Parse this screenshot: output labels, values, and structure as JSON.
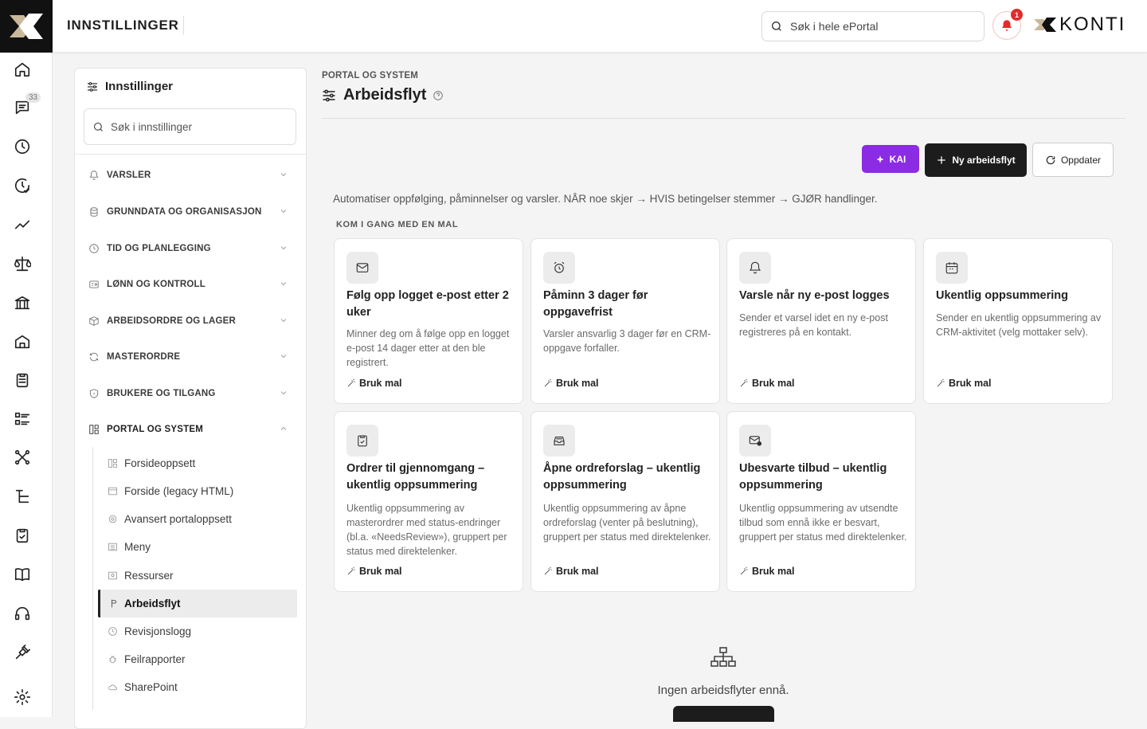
{
  "topbar": {
    "title": "INNSTILLINGER",
    "search_placeholder": "Søk i hele ePortal",
    "notification_count": "1",
    "brand": "KONTI"
  },
  "rail": {
    "chat_badge": "33"
  },
  "panel": {
    "title": "Innstillinger",
    "search_placeholder": "Søk i innstillinger",
    "sections": [
      {
        "label": "VARSLER"
      },
      {
        "label": "GRUNNDATA OG ORGANISASJON"
      },
      {
        "label": "TID OG PLANLEGGING"
      },
      {
        "label": "LØNN OG KONTROLL"
      },
      {
        "label": "ARBEIDSORDRE OG LAGER"
      },
      {
        "label": "MASTERORDRE"
      },
      {
        "label": "BRUKERE OG TILGANG"
      },
      {
        "label": "PORTAL OG SYSTEM"
      }
    ],
    "sub_items": [
      {
        "label": "Forsideoppsett"
      },
      {
        "label": "Forside (legacy HTML)"
      },
      {
        "label": "Avansert portaloppsett"
      },
      {
        "label": "Meny"
      },
      {
        "label": "Ressurser"
      },
      {
        "label": "Arbeidsflyt"
      },
      {
        "label": "Revisjonslogg"
      },
      {
        "label": "Feilrapporter"
      },
      {
        "label": "SharePoint"
      }
    ]
  },
  "main": {
    "breadcrumb": "PORTAL OG SYSTEM",
    "title": "Arbeidsflyt",
    "buttons": {
      "kai": "KAI",
      "new": "Ny arbeidsflyt",
      "update": "Oppdater"
    },
    "description": "Automatiser oppfølging, påminnelser og varsler. NÅR noe skjer → HVIS betingelser stemmer → GJØR handlinger.",
    "templates_heading": "KOM I GANG MED EN MAL",
    "templates": [
      {
        "icon": "mail-icon",
        "title": "Følg opp logget e-post etter 2 uker",
        "desc": "Minner deg om å følge opp en logget e-post 14 dager etter at den ble registrert.",
        "action": "Bruk mal"
      },
      {
        "icon": "alarm-clock-icon",
        "title": "Påminn 3 dager før oppgavefrist",
        "desc": "Varsler ansvarlig 3 dager før en CRM-oppgave forfaller.",
        "action": "Bruk mal"
      },
      {
        "icon": "bell-icon",
        "title": "Varsle når ny e-post logges",
        "desc": "Sender et varsel idet en ny e-post registreres på en kontakt.",
        "action": "Bruk mal"
      },
      {
        "icon": "calendar-icon",
        "title": "Ukentlig oppsummering",
        "desc": "Sender en ukentlig oppsummering av CRM-aktivitet (velg mottaker selv).",
        "action": "Bruk mal"
      },
      {
        "icon": "clipboard-check-icon",
        "title": "Ordrer til gjennomgang – ukentlig oppsummering",
        "desc": "Ukentlig oppsummering av masterordrer med status-endringer (bl.a. «NeedsReview»), gruppert per status med direktelenker.",
        "action": "Bruk mal"
      },
      {
        "icon": "inbox-stack-icon",
        "title": "Åpne ordreforslag – ukentlig oppsummering",
        "desc": "Ukentlig oppsummering av åpne ordreforslag (venter på beslutning), gruppert per status med direktelenker.",
        "action": "Bruk mal"
      },
      {
        "icon": "mail-alert-icon",
        "title": "Ubesvarte tilbud – ukentlig oppsummering",
        "desc": "Ukentlig oppsummering av utsendte tilbud som ennå ikke er besvart, gruppert per status med direktelenker.",
        "action": "Bruk mal"
      }
    ],
    "empty_text": "Ingen arbeidsflyter ennå."
  }
}
